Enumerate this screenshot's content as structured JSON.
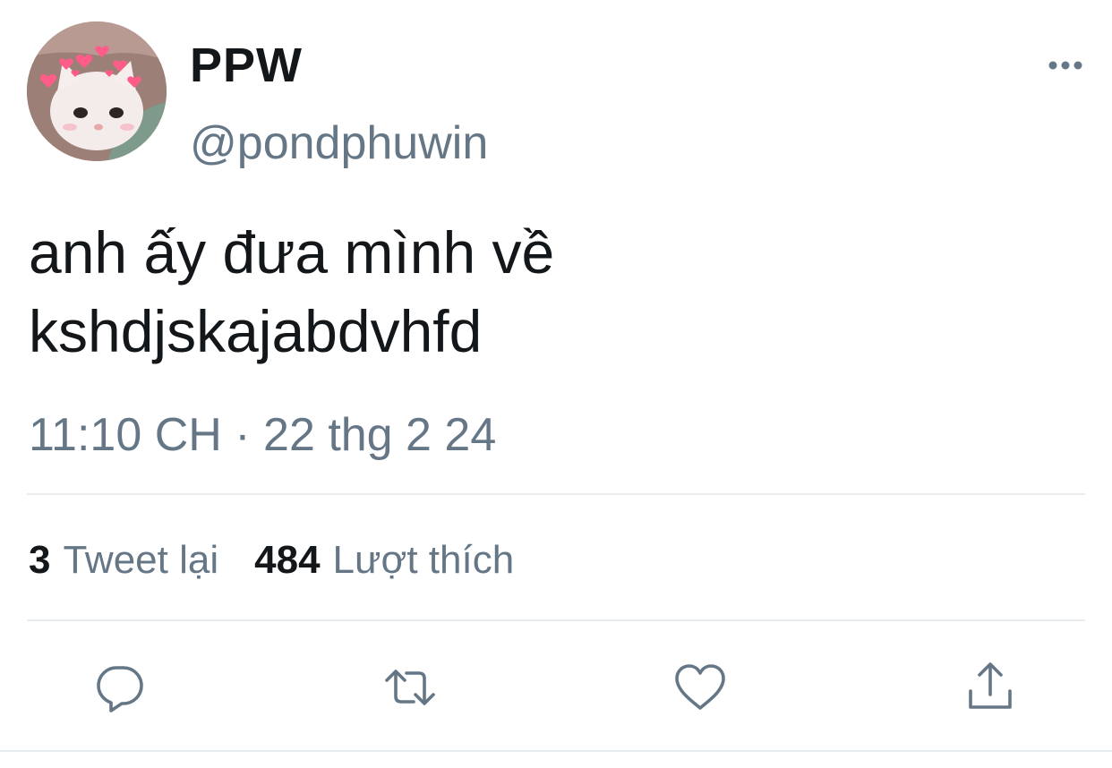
{
  "tweet": {
    "author": {
      "display_name": "PPW",
      "handle": "@pondphuwin"
    },
    "text": "anh ấy đưa mình về\nkshdjskajabdvhfd",
    "timestamp": "11:10 CH · 22 thg 2 24",
    "stats": {
      "retweets_count": "3",
      "retweets_label": "Tweet lại",
      "likes_count": "484",
      "likes_label": "Lượt thích"
    }
  },
  "icons": {
    "more": "more-horizontal-icon",
    "reply": "reply-icon",
    "retweet": "retweet-icon",
    "like": "heart-icon",
    "share": "share-icon"
  },
  "colors": {
    "primary_text": "#14171a",
    "secondary_text": "#657786",
    "divider": "#e6ecf0",
    "icon": "#657786"
  }
}
